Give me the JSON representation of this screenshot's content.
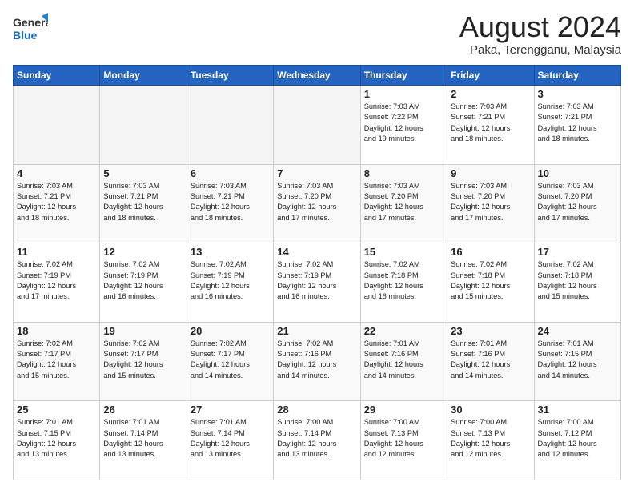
{
  "logo": {
    "line1": "General",
    "line2": "Blue"
  },
  "title": "August 2024",
  "location": "Paka, Terengganu, Malaysia",
  "days_of_week": [
    "Sunday",
    "Monday",
    "Tuesday",
    "Wednesday",
    "Thursday",
    "Friday",
    "Saturday"
  ],
  "weeks": [
    [
      {
        "day": "",
        "info": ""
      },
      {
        "day": "",
        "info": ""
      },
      {
        "day": "",
        "info": ""
      },
      {
        "day": "",
        "info": ""
      },
      {
        "day": "1",
        "info": "Sunrise: 7:03 AM\nSunset: 7:22 PM\nDaylight: 12 hours\nand 19 minutes."
      },
      {
        "day": "2",
        "info": "Sunrise: 7:03 AM\nSunset: 7:21 PM\nDaylight: 12 hours\nand 18 minutes."
      },
      {
        "day": "3",
        "info": "Sunrise: 7:03 AM\nSunset: 7:21 PM\nDaylight: 12 hours\nand 18 minutes."
      }
    ],
    [
      {
        "day": "4",
        "info": "Sunrise: 7:03 AM\nSunset: 7:21 PM\nDaylight: 12 hours\nand 18 minutes."
      },
      {
        "day": "5",
        "info": "Sunrise: 7:03 AM\nSunset: 7:21 PM\nDaylight: 12 hours\nand 18 minutes."
      },
      {
        "day": "6",
        "info": "Sunrise: 7:03 AM\nSunset: 7:21 PM\nDaylight: 12 hours\nand 18 minutes."
      },
      {
        "day": "7",
        "info": "Sunrise: 7:03 AM\nSunset: 7:20 PM\nDaylight: 12 hours\nand 17 minutes."
      },
      {
        "day": "8",
        "info": "Sunrise: 7:03 AM\nSunset: 7:20 PM\nDaylight: 12 hours\nand 17 minutes."
      },
      {
        "day": "9",
        "info": "Sunrise: 7:03 AM\nSunset: 7:20 PM\nDaylight: 12 hours\nand 17 minutes."
      },
      {
        "day": "10",
        "info": "Sunrise: 7:03 AM\nSunset: 7:20 PM\nDaylight: 12 hours\nand 17 minutes."
      }
    ],
    [
      {
        "day": "11",
        "info": "Sunrise: 7:02 AM\nSunset: 7:19 PM\nDaylight: 12 hours\nand 17 minutes."
      },
      {
        "day": "12",
        "info": "Sunrise: 7:02 AM\nSunset: 7:19 PM\nDaylight: 12 hours\nand 16 minutes."
      },
      {
        "day": "13",
        "info": "Sunrise: 7:02 AM\nSunset: 7:19 PM\nDaylight: 12 hours\nand 16 minutes."
      },
      {
        "day": "14",
        "info": "Sunrise: 7:02 AM\nSunset: 7:19 PM\nDaylight: 12 hours\nand 16 minutes."
      },
      {
        "day": "15",
        "info": "Sunrise: 7:02 AM\nSunset: 7:18 PM\nDaylight: 12 hours\nand 16 minutes."
      },
      {
        "day": "16",
        "info": "Sunrise: 7:02 AM\nSunset: 7:18 PM\nDaylight: 12 hours\nand 15 minutes."
      },
      {
        "day": "17",
        "info": "Sunrise: 7:02 AM\nSunset: 7:18 PM\nDaylight: 12 hours\nand 15 minutes."
      }
    ],
    [
      {
        "day": "18",
        "info": "Sunrise: 7:02 AM\nSunset: 7:17 PM\nDaylight: 12 hours\nand 15 minutes."
      },
      {
        "day": "19",
        "info": "Sunrise: 7:02 AM\nSunset: 7:17 PM\nDaylight: 12 hours\nand 15 minutes."
      },
      {
        "day": "20",
        "info": "Sunrise: 7:02 AM\nSunset: 7:17 PM\nDaylight: 12 hours\nand 14 minutes."
      },
      {
        "day": "21",
        "info": "Sunrise: 7:02 AM\nSunset: 7:16 PM\nDaylight: 12 hours\nand 14 minutes."
      },
      {
        "day": "22",
        "info": "Sunrise: 7:01 AM\nSunset: 7:16 PM\nDaylight: 12 hours\nand 14 minutes."
      },
      {
        "day": "23",
        "info": "Sunrise: 7:01 AM\nSunset: 7:16 PM\nDaylight: 12 hours\nand 14 minutes."
      },
      {
        "day": "24",
        "info": "Sunrise: 7:01 AM\nSunset: 7:15 PM\nDaylight: 12 hours\nand 14 minutes."
      }
    ],
    [
      {
        "day": "25",
        "info": "Sunrise: 7:01 AM\nSunset: 7:15 PM\nDaylight: 12 hours\nand 13 minutes."
      },
      {
        "day": "26",
        "info": "Sunrise: 7:01 AM\nSunset: 7:14 PM\nDaylight: 12 hours\nand 13 minutes."
      },
      {
        "day": "27",
        "info": "Sunrise: 7:01 AM\nSunset: 7:14 PM\nDaylight: 12 hours\nand 13 minutes."
      },
      {
        "day": "28",
        "info": "Sunrise: 7:00 AM\nSunset: 7:14 PM\nDaylight: 12 hours\nand 13 minutes."
      },
      {
        "day": "29",
        "info": "Sunrise: 7:00 AM\nSunset: 7:13 PM\nDaylight: 12 hours\nand 12 minutes."
      },
      {
        "day": "30",
        "info": "Sunrise: 7:00 AM\nSunset: 7:13 PM\nDaylight: 12 hours\nand 12 minutes."
      },
      {
        "day": "31",
        "info": "Sunrise: 7:00 AM\nSunset: 7:12 PM\nDaylight: 12 hours\nand 12 minutes."
      }
    ]
  ]
}
